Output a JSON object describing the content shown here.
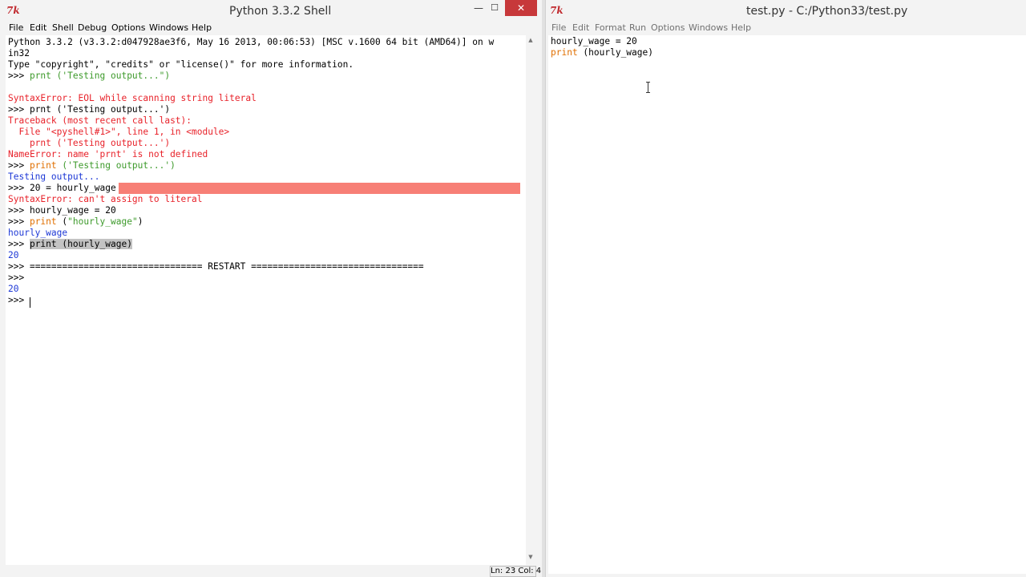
{
  "shell": {
    "title": "Python 3.3.2 Shell",
    "controls": {
      "minimize": "—",
      "maximize": "☐",
      "close": "✕"
    },
    "menu": [
      "File",
      "Edit",
      "Shell",
      "Debug",
      "Options",
      "Windows",
      "Help"
    ],
    "output": {
      "banner1": "Python 3.3.2 (v3.3.2:d047928ae3f6, May 16 2013, 00:06:53) [MSC v.1600 64 bit (AMD64)] on w",
      "banner2": "in32",
      "banner3": "Type \"copyright\", \"credits\" or \"license()\" for more information.",
      "prompt": ">>> ",
      "cmd1": "prnt ('Testing output...\")",
      "err1": "SyntaxError: EOL while scanning string literal",
      "cmd2": "prnt ('Testing output...')",
      "tb1": "Traceback (most recent call last):",
      "tb2": "  File \"<pyshell#1>\", line 1, in <module>",
      "tb3": "    prnt ('Testing output...')",
      "err2": "NameError: name 'prnt' is not defined",
      "cmd3_keyword": "print",
      "cmd3_rest": " ('Testing output...')",
      "out3": "Testing output...",
      "cmd4": "20 = hourly_wage",
      "err4": "SyntaxError: can't assign to literal",
      "cmd5": "hourly_wage = 20",
      "cmd6_keyword": "print",
      "cmd6_open": " (",
      "cmd6_string": "\"hourly_wage\"",
      "cmd6_close": ")",
      "out6": "hourly_wage",
      "cmd7": "print (hourly_wage)",
      "out7": "20",
      "restart": "================================ RESTART ================================",
      "prompt_bare": ">>>",
      "out8": "20"
    },
    "status": "Ln: 23 Col: 4"
  },
  "editor": {
    "title": "test.py - C:/Python33/test.py",
    "menu": [
      "File",
      "Edit",
      "Format",
      "Run",
      "Options",
      "Windows",
      "Help"
    ],
    "line1": "hourly_wage = 20",
    "line2_keyword": "print",
    "line2_rest": " (hourly_wage)"
  },
  "colors": {
    "error": "#e8222a",
    "string": "#3d9a2b",
    "output": "#1d38d6",
    "keyword": "#e06f00",
    "error_highlight": "#f77f76",
    "close_button": "#c7383a"
  },
  "icons": {
    "app": "tk-feather-icon",
    "cursor": "i-beam-cursor-icon"
  }
}
